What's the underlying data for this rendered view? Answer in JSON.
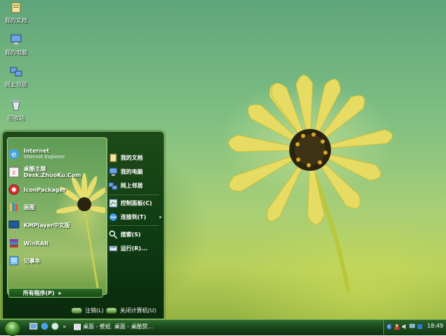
{
  "desktop": {
    "icons": [
      {
        "label": "我的文档",
        "icon": "my-documents-icon"
      },
      {
        "label": "我的电脑",
        "icon": "my-computer-icon"
      },
      {
        "label": "网上邻居",
        "icon": "network-places-icon"
      },
      {
        "label": "回收站",
        "icon": "recycle-bin-icon"
      }
    ]
  },
  "start_menu": {
    "pinned": [
      {
        "title": "Internet",
        "subtitle": "Internet Explorer",
        "icon": "internet-explorer-icon"
      },
      {
        "title": "桌酷主题Desk.ZhuoKu.Com",
        "subtitle": "",
        "icon": "zhuoku-icon"
      },
      {
        "title": "IconPackager",
        "subtitle": "",
        "icon": "iconpackager-icon"
      },
      {
        "title": "画图",
        "subtitle": "",
        "icon": "paint-icon"
      },
      {
        "title": "KMPlayer中文版",
        "subtitle": "",
        "icon": "kmplayer-icon"
      },
      {
        "title": "WinRAR",
        "subtitle": "",
        "icon": "winrar-icon"
      },
      {
        "title": "记事本",
        "subtitle": "",
        "icon": "notepad-icon"
      }
    ],
    "all_programs": "所有程序(P)",
    "right": [
      {
        "label": "我的文档",
        "icon": "my-documents-icon"
      },
      {
        "label": "我的电脑",
        "icon": "my-computer-icon"
      },
      {
        "label": "网上邻居",
        "icon": "network-places-icon"
      },
      {
        "label": "控制面板(C)",
        "icon": "control-panel-icon"
      },
      {
        "label": "连接到(T)",
        "icon": "connect-to-icon",
        "submenu": "▸"
      },
      {
        "label": "搜索(S)",
        "icon": "search-icon"
      },
      {
        "label": "运行(R)...",
        "icon": "run-icon"
      }
    ],
    "logoff": "注销(L)",
    "shutdown": "关闭计算机(U)"
  },
  "taskbar": {
    "tasks": [
      "桌面 - 壁纸",
      "桌面 - 桌酷赞..."
    ],
    "chevron": "»",
    "clock": "18:49"
  },
  "colors": {
    "accent": "#2f6a2d",
    "border": "#7bb35a"
  }
}
